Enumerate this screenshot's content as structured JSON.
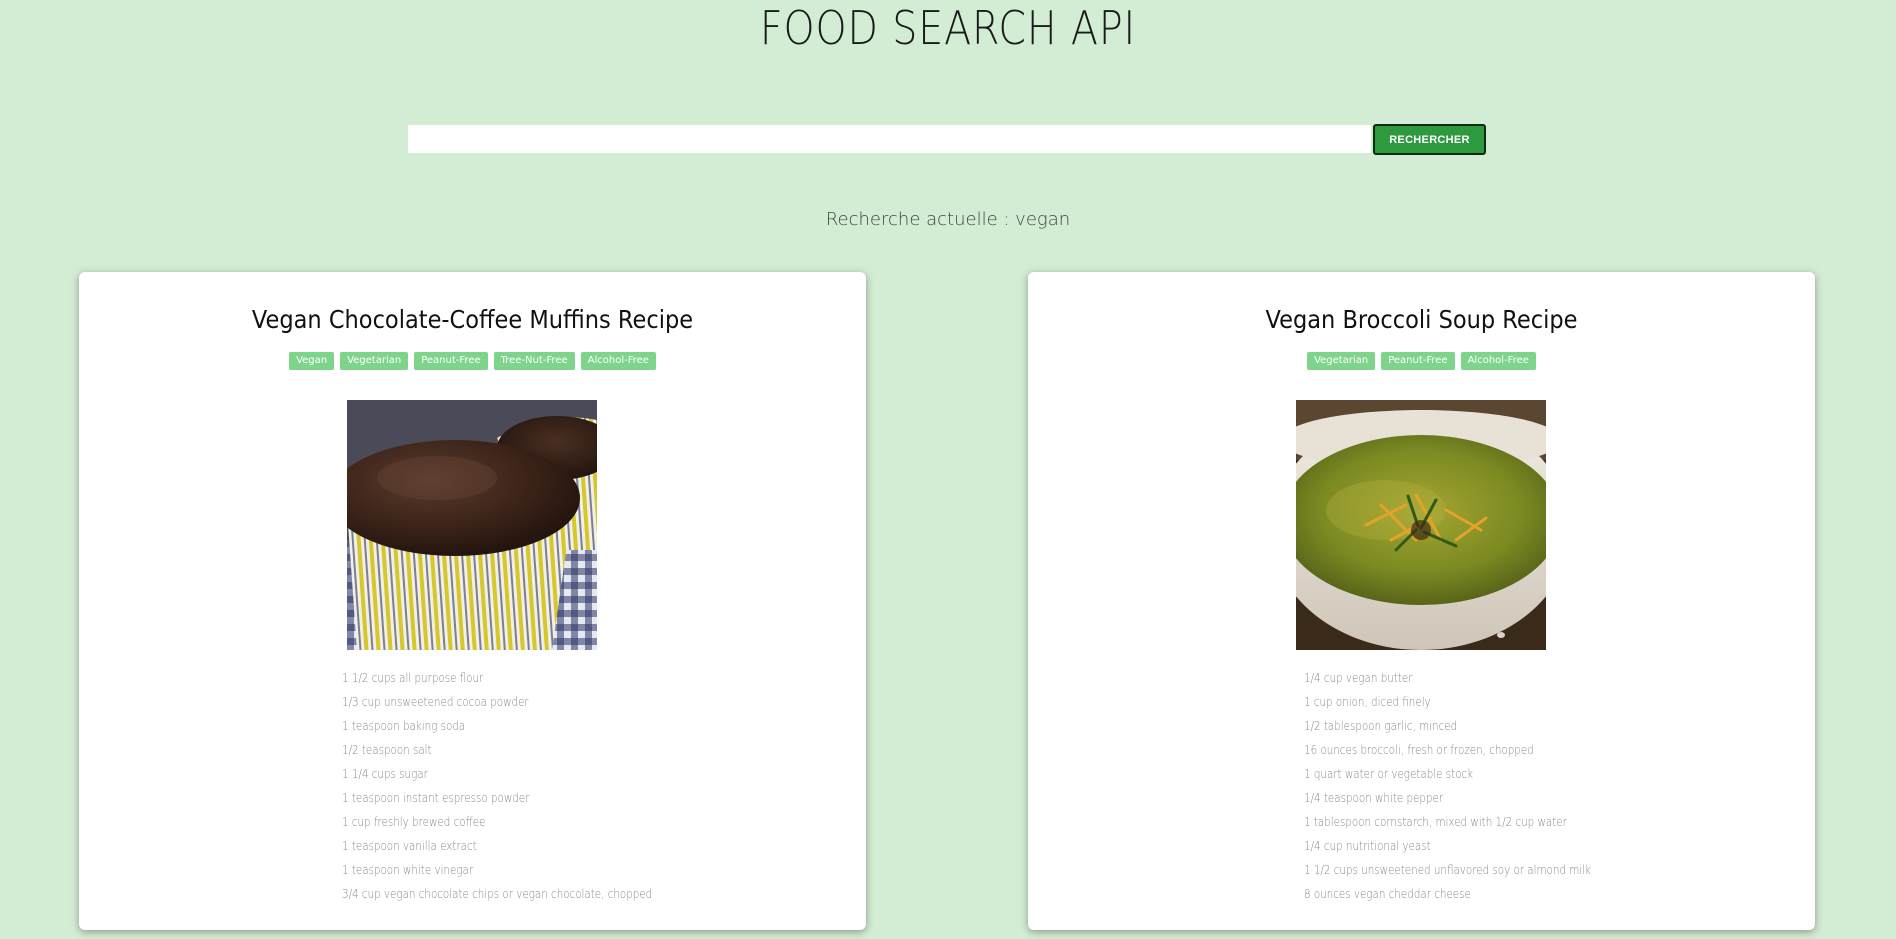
{
  "header": {
    "title": "FOOD SEARCH API"
  },
  "search": {
    "value": "",
    "placeholder": "",
    "button_label": "RECHERCHER",
    "button_color": "#2e9a3f"
  },
  "current_search": {
    "text": "Recherche actuelle : vegan"
  },
  "theme": {
    "background": "#d3ecd4",
    "label_color": "#7ed48a"
  },
  "recipes": [
    {
      "title": "Vegan Chocolate-Coffee Muffins Recipe",
      "labels": [
        "Vegan",
        "Vegetarian",
        "Peanut-Free",
        "Tree-Nut-Free",
        "Alcohol-Free"
      ],
      "image_subject": "chocolate muffins in yellow-striped paper cups",
      "ingredients": [
        "1 1/2 cups all purpose flour",
        "1/3 cup unsweetened cocoa powder",
        "1 teaspoon baking soda",
        "1/2 teaspoon salt",
        "1 1/4 cups sugar",
        "1 teaspoon instant espresso powder",
        "1 cup freshly brewed coffee",
        "1 teaspoon vanilla extract",
        "1 teaspoon white vinegar",
        "3/4 cup vegan chocolate chips or vegan chocolate, chopped"
      ]
    },
    {
      "title": "Vegan Broccoli Soup Recipe",
      "labels": [
        "Vegetarian",
        "Peanut-Free",
        "Alcohol-Free"
      ],
      "image_subject": "green broccoli soup in a white bowl",
      "ingredients": [
        "1/4 cup vegan butter",
        "1 cup onion, diced finely",
        "1/2 tablespoon garlic, minced",
        "16 ounces broccoli, fresh or frozen, chopped",
        "1 quart water or vegetable stock",
        "1/4 teaspoon white pepper",
        "1 tablespoon cornstarch, mixed with 1/2 cup water",
        "1/4 cup nutritional yeast",
        "1 1/2 cups unsweetened unflavored soy or almond milk",
        "8 ounces vegan cheddar cheese"
      ]
    }
  ]
}
